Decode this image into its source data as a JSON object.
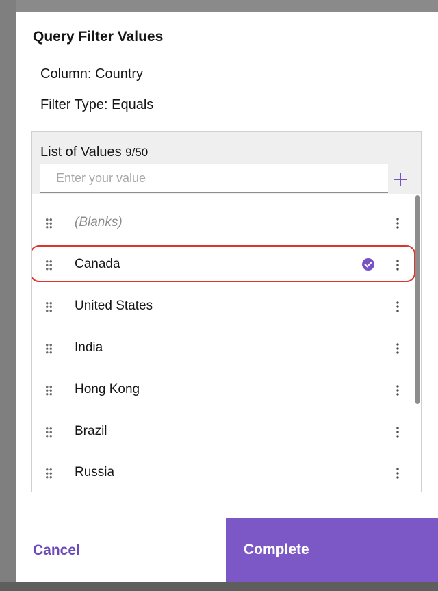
{
  "dialog": {
    "title": "Query Filter Values",
    "column_line": "Column: Country",
    "filter_type_line": "Filter Type: Equals"
  },
  "values_panel": {
    "heading": "List of Values",
    "count": "9/50",
    "input_placeholder": "Enter your value",
    "input_value": "",
    "add_icon": "plus-icon",
    "items": [
      {
        "label": "(Blanks)",
        "selected": false
      },
      {
        "label": "Canada",
        "selected": true
      },
      {
        "label": "United States",
        "selected": false
      },
      {
        "label": "India",
        "selected": false
      },
      {
        "label": "Hong Kong",
        "selected": false
      },
      {
        "label": "Brazil",
        "selected": false
      },
      {
        "label": "Russia",
        "selected": false
      }
    ]
  },
  "footer": {
    "cancel_label": "Cancel",
    "complete_label": "Complete"
  },
  "colors": {
    "accent": "#7c57c6",
    "highlight": "#e0332a"
  }
}
